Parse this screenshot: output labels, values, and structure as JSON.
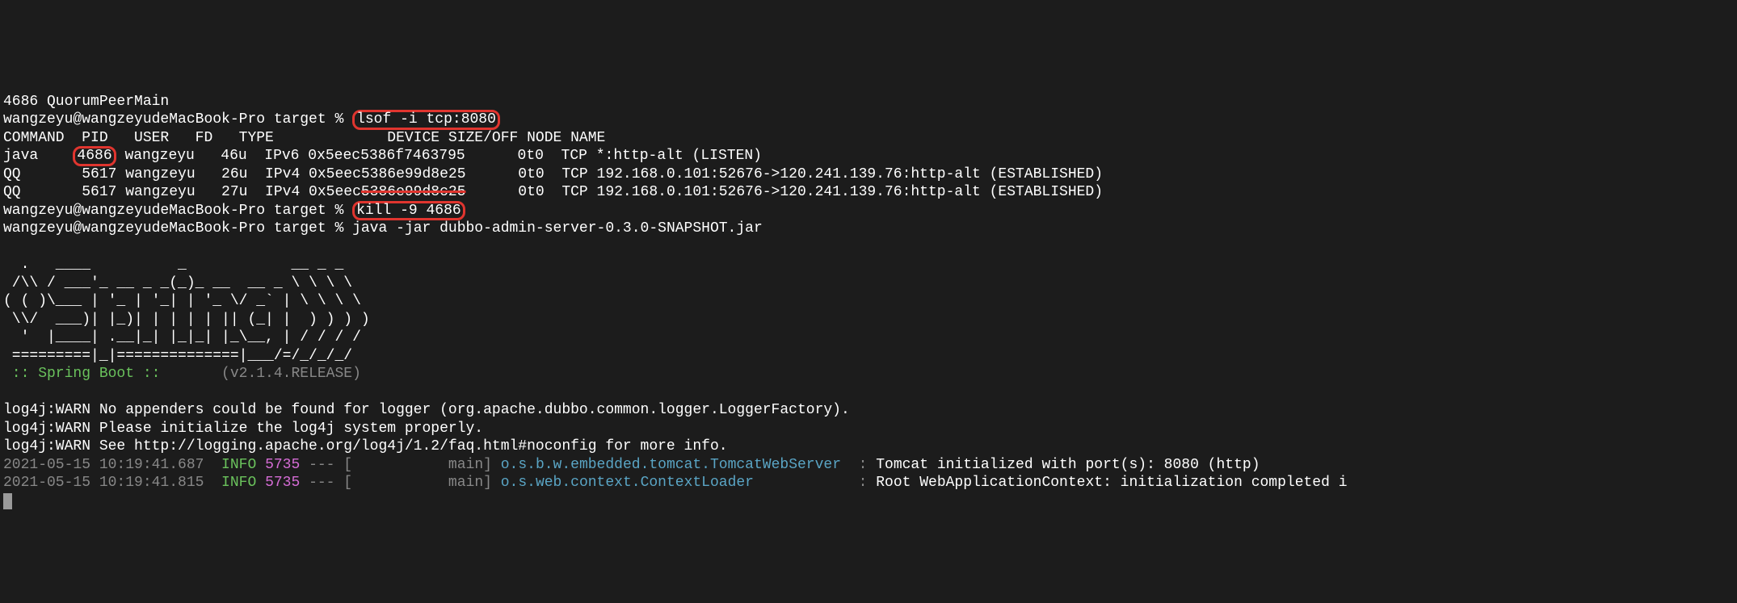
{
  "line_prev": "4686 QuorumPeerMain",
  "prompt": "wangzeyu@wangzeyudeMacBook-Pro target % ",
  "cmd_lsof": "lsof -i tcp:8080",
  "table": {
    "header": "COMMAND  PID   USER   FD   TYPE             DEVICE SIZE/OFF NODE NAME",
    "rows": [
      {
        "a": "java    ",
        "pid": "4686",
        "b": " wangzeyu   46u  IPv6 0x5eec5386f7463795      0t0  TCP *:http-alt (LISTEN)"
      },
      {
        "a": "QQ       5617 wangzeyu   26u  IPv4 0x5eec5386e99d8e25      0t0  TCP 192.168.0.101:52676->120.241.139.76:http-alt (ESTABLISHED)",
        "pid": "",
        "b": ""
      },
      {
        "a": "QQ       5617 wangzeyu   27u  IPv4 0x5eec",
        "strike": "5386e99d8c25",
        "b": "      0t0  TCP 192.168.0.101:52676->120.241.139.76:http-alt (ESTABLISHED)"
      }
    ]
  },
  "cmd_kill": "kill -9 4686",
  "cmd_java": "java -jar dubbo-admin-server-0.3.0-SNAPSHOT.jar",
  "ascii": "  .   ____          _            __ _ _\n /\\\\ / ___'_ __ _ _(_)_ __  __ _ \\ \\ \\ \\\n( ( )\\___ | '_ | '_| | '_ \\/ _` | \\ \\ \\ \\\n \\\\/  ___)| |_)| | | | | || (_| |  ) ) ) )\n  '  |____| .__|_| |_|_| |_\\__, | / / / /\n =========|_|==============|___/=/_/_/_/",
  "spring_label": " :: Spring Boot ::       ",
  "spring_version": "(v2.1.4.RELEASE)",
  "log4j": [
    "log4j:WARN No appenders could be found for logger (org.apache.dubbo.common.logger.LoggerFactory).",
    "log4j:WARN Please initialize the log4j system properly.",
    "log4j:WARN See http://logging.apache.org/log4j/1.2/faq.html#noconfig for more info."
  ],
  "loglines": [
    {
      "ts": "2021-05-15 10:19:41.687  ",
      "level": "INFO",
      "pid": " 5735",
      "mid": " --- [           main] ",
      "logger": "o.s.b.w.embedded.tomcat.TomcatWebServer ",
      "colon": " : ",
      "msg": "Tomcat initialized with port(s): 8080 (http)"
    },
    {
      "ts": "2021-05-15 10:19:41.815  ",
      "level": "INFO",
      "pid": " 5735",
      "mid": " --- [           main] ",
      "logger": "o.s.web.context.ContextLoader           ",
      "colon": " : ",
      "msg": "Root WebApplicationContext: initialization completed i"
    }
  ]
}
